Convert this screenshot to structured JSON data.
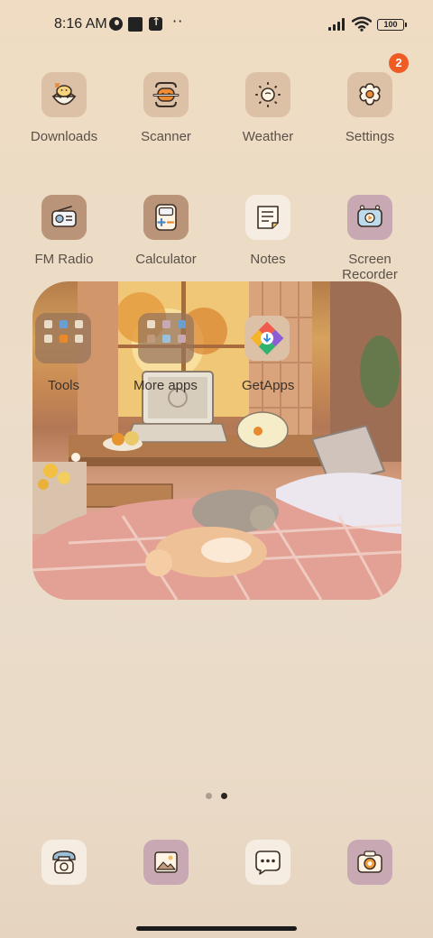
{
  "status_bar": {
    "time": "8:16 AM",
    "battery": "100",
    "icons": [
      "notification-icon",
      "square-notification-icon",
      "upload-notification-icon",
      "more-dots-icon",
      "signal-icon",
      "wifi-icon",
      "battery-icon"
    ]
  },
  "apps_row1": [
    {
      "label": "Downloads",
      "icon": "downloads-icon"
    },
    {
      "label": "Scanner",
      "icon": "scanner-icon"
    },
    {
      "label": "Weather",
      "icon": "weather-icon"
    },
    {
      "label": "Settings",
      "icon": "settings-icon",
      "badge": "2"
    }
  ],
  "apps_row2": [
    {
      "label": "FM Radio",
      "icon": "radio-icon"
    },
    {
      "label": "Calculator",
      "icon": "calculator-icon"
    },
    {
      "label": "Notes",
      "icon": "notes-icon"
    },
    {
      "label": "Screen Recorder",
      "icon": "screen-recorder-icon"
    }
  ],
  "widget": {
    "folders": [
      {
        "label": "Tools",
        "icon": "tools-folder-icon"
      },
      {
        "label": "More apps",
        "icon": "more-apps-folder-icon"
      }
    ],
    "app": {
      "label": "GetApps",
      "icon": "getapps-icon"
    }
  },
  "pager": {
    "pages": 2,
    "current": 2
  },
  "dock": [
    {
      "icon": "phone-icon"
    },
    {
      "icon": "gallery-icon"
    },
    {
      "icon": "messages-icon"
    },
    {
      "icon": "camera-icon"
    }
  ],
  "colors": {
    "badge": "#ef5b24",
    "icon_tan": "#dcc1a6",
    "icon_cream": "#f6ede2",
    "icon_mauve": "#c8a9b3"
  }
}
